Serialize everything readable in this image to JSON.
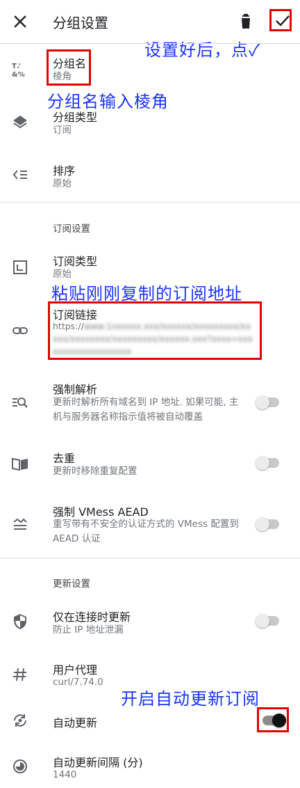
{
  "toolbar": {
    "title": "分组设置",
    "close_icon": "close-icon",
    "delete_icon": "delete-icon",
    "confirm_icon": "check-icon"
  },
  "rows": {
    "group_name": {
      "title": "分组名",
      "value": "棱角",
      "icon": "text-format-icon"
    },
    "group_type": {
      "title": "分组类型",
      "value": "订阅",
      "icon": "layers-icon"
    },
    "sort": {
      "title": "排序",
      "value": "原始",
      "icon": "sort-icon"
    }
  },
  "subscription_section": {
    "header": "订阅设置",
    "type": {
      "title": "订阅类型",
      "value": "原始",
      "icon": "subscription-type-icon"
    },
    "link": {
      "title": "订阅链接",
      "value_prefix": "https://",
      "value_blurred": "www.1xxxxxx.xxx/xxxxxx/xxxxxxxxx/xxxxx/xxxxxxxx/xxxxxxxxx/xxxxxx.xxx?xxxx=xxxxxxxxxxxxxxxxxxx",
      "icon": "link-icon"
    },
    "force_resolve": {
      "title": "强制解析",
      "desc": "更新时解析所有域名到 IP 地址. 如果可能, 主机与服务器名称指示值将被自动覆盖",
      "icon": "dns-search-icon",
      "enabled": false
    },
    "dedup": {
      "title": "去重",
      "desc": "更新时移除重复配置",
      "icon": "book-icon",
      "enabled": false
    },
    "vmess_aead": {
      "title": "强制 VMess AEAD",
      "desc": "重写带有不安全的认证方式的 VMess 配置到 AEAD 认证",
      "icon": "waves-icon",
      "enabled": false
    }
  },
  "update_section": {
    "header": "更新设置",
    "only_connected": {
      "title": "仅在连接时更新",
      "desc": "防止 IP 地址泄漏",
      "icon": "shield-icon",
      "enabled": false
    },
    "user_agent": {
      "title": "用户代理",
      "value": "curl/7.74.0",
      "icon": "hash-icon"
    },
    "auto_update": {
      "title": "自动更新",
      "icon": "sync-icon",
      "enabled": true
    },
    "auto_update_interval": {
      "title": "自动更新间隔 (分)",
      "value": "1440",
      "icon": "timelapse-icon"
    }
  },
  "annotations": {
    "save_hint": "设置好后，点✓",
    "name_hint": "分组名输入棱角",
    "link_hint": "粘贴刚刚复制的订阅地址",
    "auto_hint": "开启自动更新订阅"
  },
  "colors": {
    "highlight": "#e50000",
    "annotation": "#1a33ff",
    "text_primary": "#202124",
    "text_secondary": "#70757a"
  }
}
